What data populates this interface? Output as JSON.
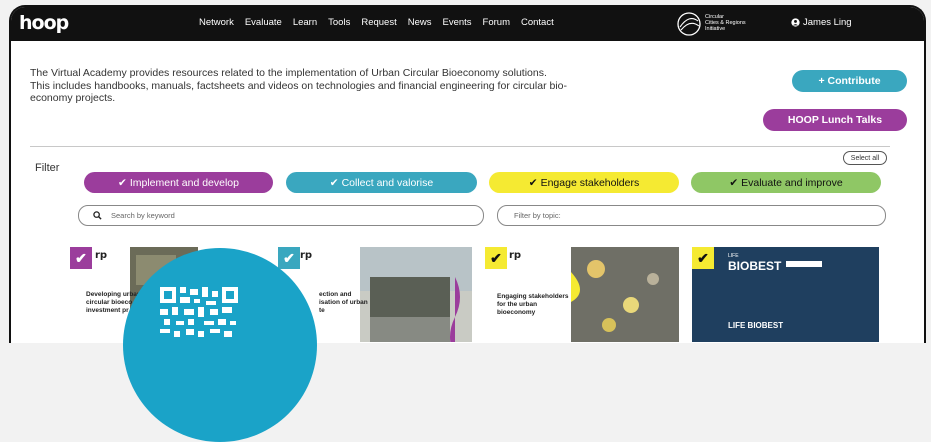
{
  "header": {
    "logo": "hoop",
    "nav": [
      "Network",
      "Evaluate",
      "Learn",
      "Tools",
      "Request",
      "News",
      "Events",
      "Forum",
      "Contact"
    ],
    "partner_logo_text": [
      "Circular",
      "Cities & Regions",
      "Initiative"
    ],
    "user_name": "James Ling"
  },
  "intro": {
    "line1": "The Virtual Academy provides resources related to the implementation of Urban Circular Bioeconomy solutions.",
    "line2": "This includes handbooks, manuals, factsheets and videos on technologies and financial engineering for circular bio-",
    "line3": "economy projects."
  },
  "actions": {
    "contribute": "+ Contribute",
    "lunch_talks": "HOOP Lunch Talks"
  },
  "filter": {
    "label": "Filter",
    "select_all": "Select all",
    "chips": [
      {
        "label": "Implement and develop",
        "color": "#9b3d9c"
      },
      {
        "label": "Collect and valorise",
        "color": "#3aa7bf"
      },
      {
        "label": "Engage stakeholders",
        "color": "#f5ea32"
      },
      {
        "label": "Evaluate and improve",
        "color": "#8fc765"
      }
    ],
    "search_placeholder": "Search by keyword",
    "topic_placeholder": "Filter by topic:"
  },
  "cards": [
    {
      "logo": "rp",
      "title": [
        "Developing urban",
        "circular bioeco",
        "investment pr"
      ]
    },
    {
      "logo": "rp",
      "title": [
        "ection and",
        "isation of urban",
        "te"
      ]
    },
    {
      "logo": "rp",
      "title": [
        "Engaging stakeholders",
        "for the urban",
        "bioeconomy"
      ]
    },
    {
      "logo": "BIOBEST",
      "logo_prefix": "LIFE",
      "title": [
        "LIFE BIOBEST"
      ]
    }
  ]
}
